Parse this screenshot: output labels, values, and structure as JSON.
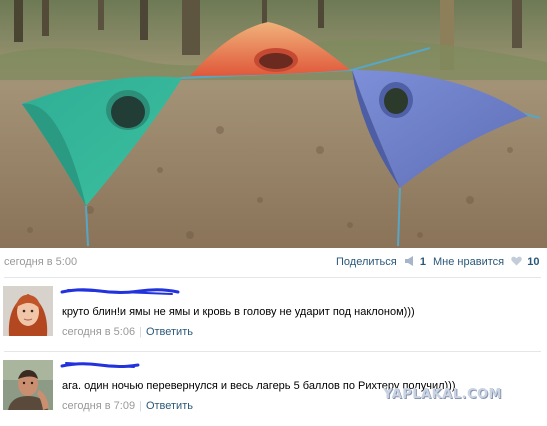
{
  "post": {
    "time": "сегодня в 5:00",
    "share_label": "Поделиться",
    "share_count": "1",
    "like_label": "Мне нравится",
    "like_count": "10"
  },
  "comments": [
    {
      "text": "круто блин!и ямы не ямы и кровь в голову не ударит под наклоном)))",
      "time": "сегодня в 5:06",
      "reply_label": "Ответить"
    },
    {
      "text": "ага. один ночью перевернулся и весь лагерь 5 баллов по Рихтеру получил)))",
      "time": "сегодня в 7:09",
      "reply_label": "Ответить"
    }
  ],
  "watermark": "YAPLAKAL.COM",
  "colors": {
    "link": "#2b587a",
    "muted": "#999999",
    "tent_left": "#3ab39a",
    "tent_middle": "#e8693a",
    "tent_right": "#6c7fc4",
    "author_scribble": "#2233dd"
  }
}
